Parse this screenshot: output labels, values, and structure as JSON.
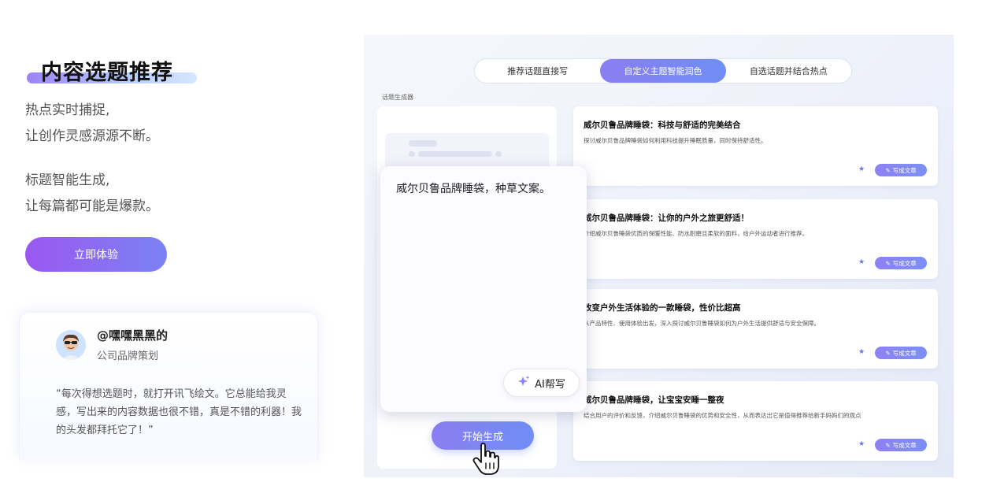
{
  "hero": {
    "title": "内容选题推荐",
    "desc1_line1": "热点实时捕捉,",
    "desc1_line2": "让创作灵感源源不断。",
    "desc2_line1": "标题智能生成,",
    "desc2_line2": "让每篇都可能是爆款。",
    "cta_label": "立即体验"
  },
  "testimonial": {
    "user_name": "@嘿嘿黑黑的",
    "user_role": "公司品牌策划",
    "quote": "“每次得想选题时，就打开讯飞绘文。它总能给我灵感，写出来的内容数据也很不错，真是不错的利器！我的头发都拜托它了！”"
  },
  "demo": {
    "tabs": [
      {
        "label": "推荐话题直接写",
        "active": false
      },
      {
        "label": "自定义主题智能润色",
        "active": true
      },
      {
        "label": "自选话题并结合热点",
        "active": false
      }
    ],
    "history_label": "话题生成器",
    "prompt_text": "威尔贝鲁品牌睡袋，种草文案。",
    "ai_button_label": "AI帮写",
    "start_button_label": "开始生成",
    "results": [
      {
        "title": "威尔贝鲁品牌睡袋：科技与舒适的完美结合",
        "desc": "探讨威尔贝鲁品牌睡袋如何利用科技提升睡眠质量，同时保持舒适性。",
        "write_label": "写成文章"
      },
      {
        "title": "威尔贝鲁品牌睡袋：让你的户外之旅更舒适！",
        "desc": "介绍威尔贝鲁睡袋优质的保暖性能、防水耐磨且柔软的面料，给户外运动者进行推荐。",
        "write_label": "写成文章"
      },
      {
        "title": "改变户外生活体验的一款睡袋，性价比超高",
        "desc": "从产品特性、使用体验出发，深入探讨威尔贝鲁睡袋如何为户外生活提供舒适与安全保障。",
        "write_label": "写成文章"
      },
      {
        "title": "威尔贝鲁品牌睡袋，让宝宝安睡一整夜",
        "desc": "结合用户的评价和反馈，介绍威尔贝鲁睡袋的优势和安全性，从而表达出它是值得推荐给新手妈妈们的观点",
        "write_label": "写成文章"
      }
    ]
  },
  "colors": {
    "accent_purple": "#9a58f1",
    "accent_blue": "#6f8ef5",
    "panel_bg": "#eef1fa"
  },
  "icons": {
    "ai": "sparkle-icon",
    "write": "pencil-icon",
    "star": "star-icon",
    "pointer": "hand-pointer-icon"
  }
}
